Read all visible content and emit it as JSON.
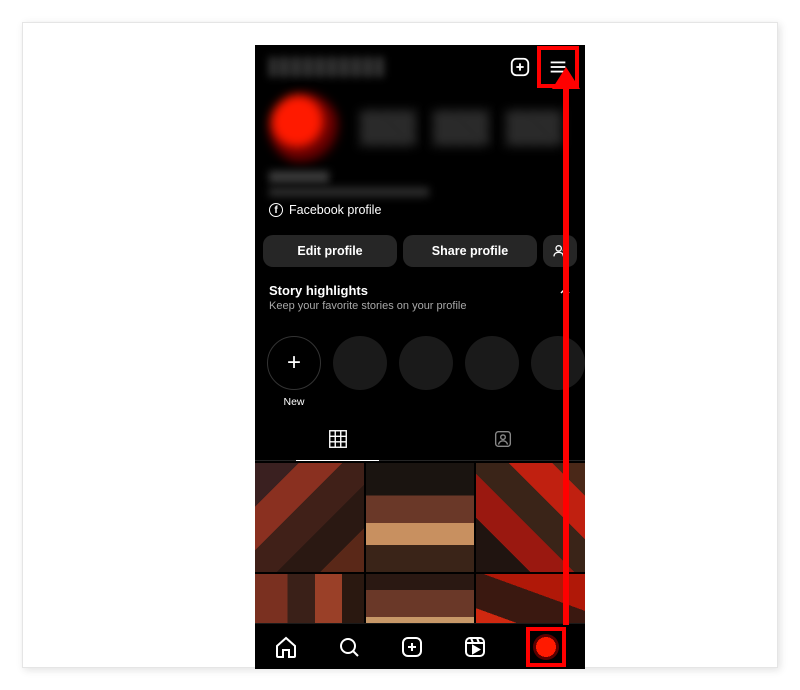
{
  "header": {
    "create_label": "Create",
    "menu_label": "Menu"
  },
  "profile": {
    "fb_link_text": "Facebook profile"
  },
  "buttons": {
    "edit": "Edit profile",
    "share": "Share profile"
  },
  "highlights": {
    "title": "Story highlights",
    "subtitle": "Keep your favorite stories on your profile",
    "new_label": "New"
  },
  "tabs": {
    "grid": "Posts grid",
    "tagged": "Tagged"
  },
  "nav": {
    "home": "Home",
    "search": "Search",
    "create": "Create",
    "reels": "Reels",
    "profile": "Profile"
  },
  "colors": {
    "highlight": "#ff0000",
    "bg": "#000000",
    "pill": "#262626"
  }
}
